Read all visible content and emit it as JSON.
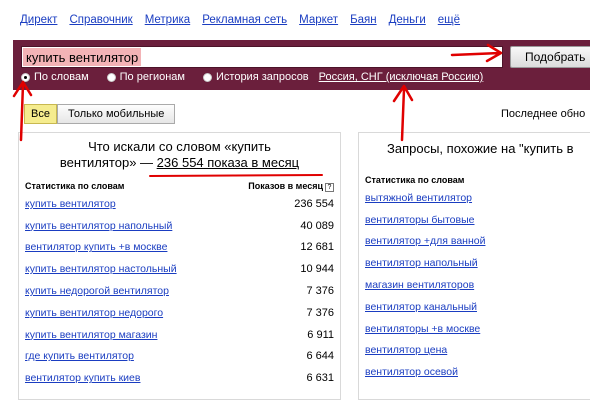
{
  "nav": {
    "links": [
      "Директ",
      "Справочник",
      "Метрика",
      "Рекламная сеть",
      "Маркет",
      "Баян",
      "Деньги",
      "ещё"
    ]
  },
  "search": {
    "query": "купить вентилятор",
    "submit_label": "Подобрать",
    "options": [
      {
        "label": "По словам",
        "selected": true
      },
      {
        "label": "По регионам",
        "selected": false
      },
      {
        "label": "История запросов",
        "selected": false
      }
    ],
    "region": "Россия, СНГ (исключая Россию)"
  },
  "tabs": {
    "all": "Все",
    "mobile": "Только мобильные"
  },
  "last_updated": "Последнее обно",
  "left_panel": {
    "title_1": "Что искали со словом «купить",
    "title_2": "вентилятор» — ",
    "title_count": "236 554 показа в месяц",
    "col_stats": "Статистика по словам",
    "col_shows": "Показов в месяц",
    "help": "?",
    "rows": [
      {
        "kw": "купить вентилятор",
        "num": "236 554"
      },
      {
        "kw": "купить вентилятор напольный",
        "num": "40 089"
      },
      {
        "kw": "вентилятор купить +в москве",
        "num": "12 681"
      },
      {
        "kw": "купить вентилятор настольный",
        "num": "10 944"
      },
      {
        "kw": "купить недорогой вентилятор",
        "num": "7 376"
      },
      {
        "kw": "купить вентилятор недорого",
        "num": "7 376"
      },
      {
        "kw": "купить вентилятор магазин",
        "num": "6 911"
      },
      {
        "kw": "где купить вентилятор",
        "num": "6 644"
      },
      {
        "kw": "вентилятор купить киев",
        "num": "6 631"
      }
    ]
  },
  "right_panel": {
    "title": "Запросы, похожие на \"купить в",
    "col_stats": "Статистика по словам",
    "rows": [
      "вытяжной вентилятор",
      "вентиляторы бытовые",
      "вентилятор +для ванной",
      "вентилятор напольный",
      "магазин вентиляторов",
      "вентилятор канальный",
      "вентиляторы +в москве",
      "вентилятор цена",
      "вентилятор осевой"
    ]
  },
  "colors": {
    "bar": "#6b1f3c",
    "link": "#1a3dc1",
    "annotation": "#e00000",
    "highlight": "#f3b3b6"
  }
}
